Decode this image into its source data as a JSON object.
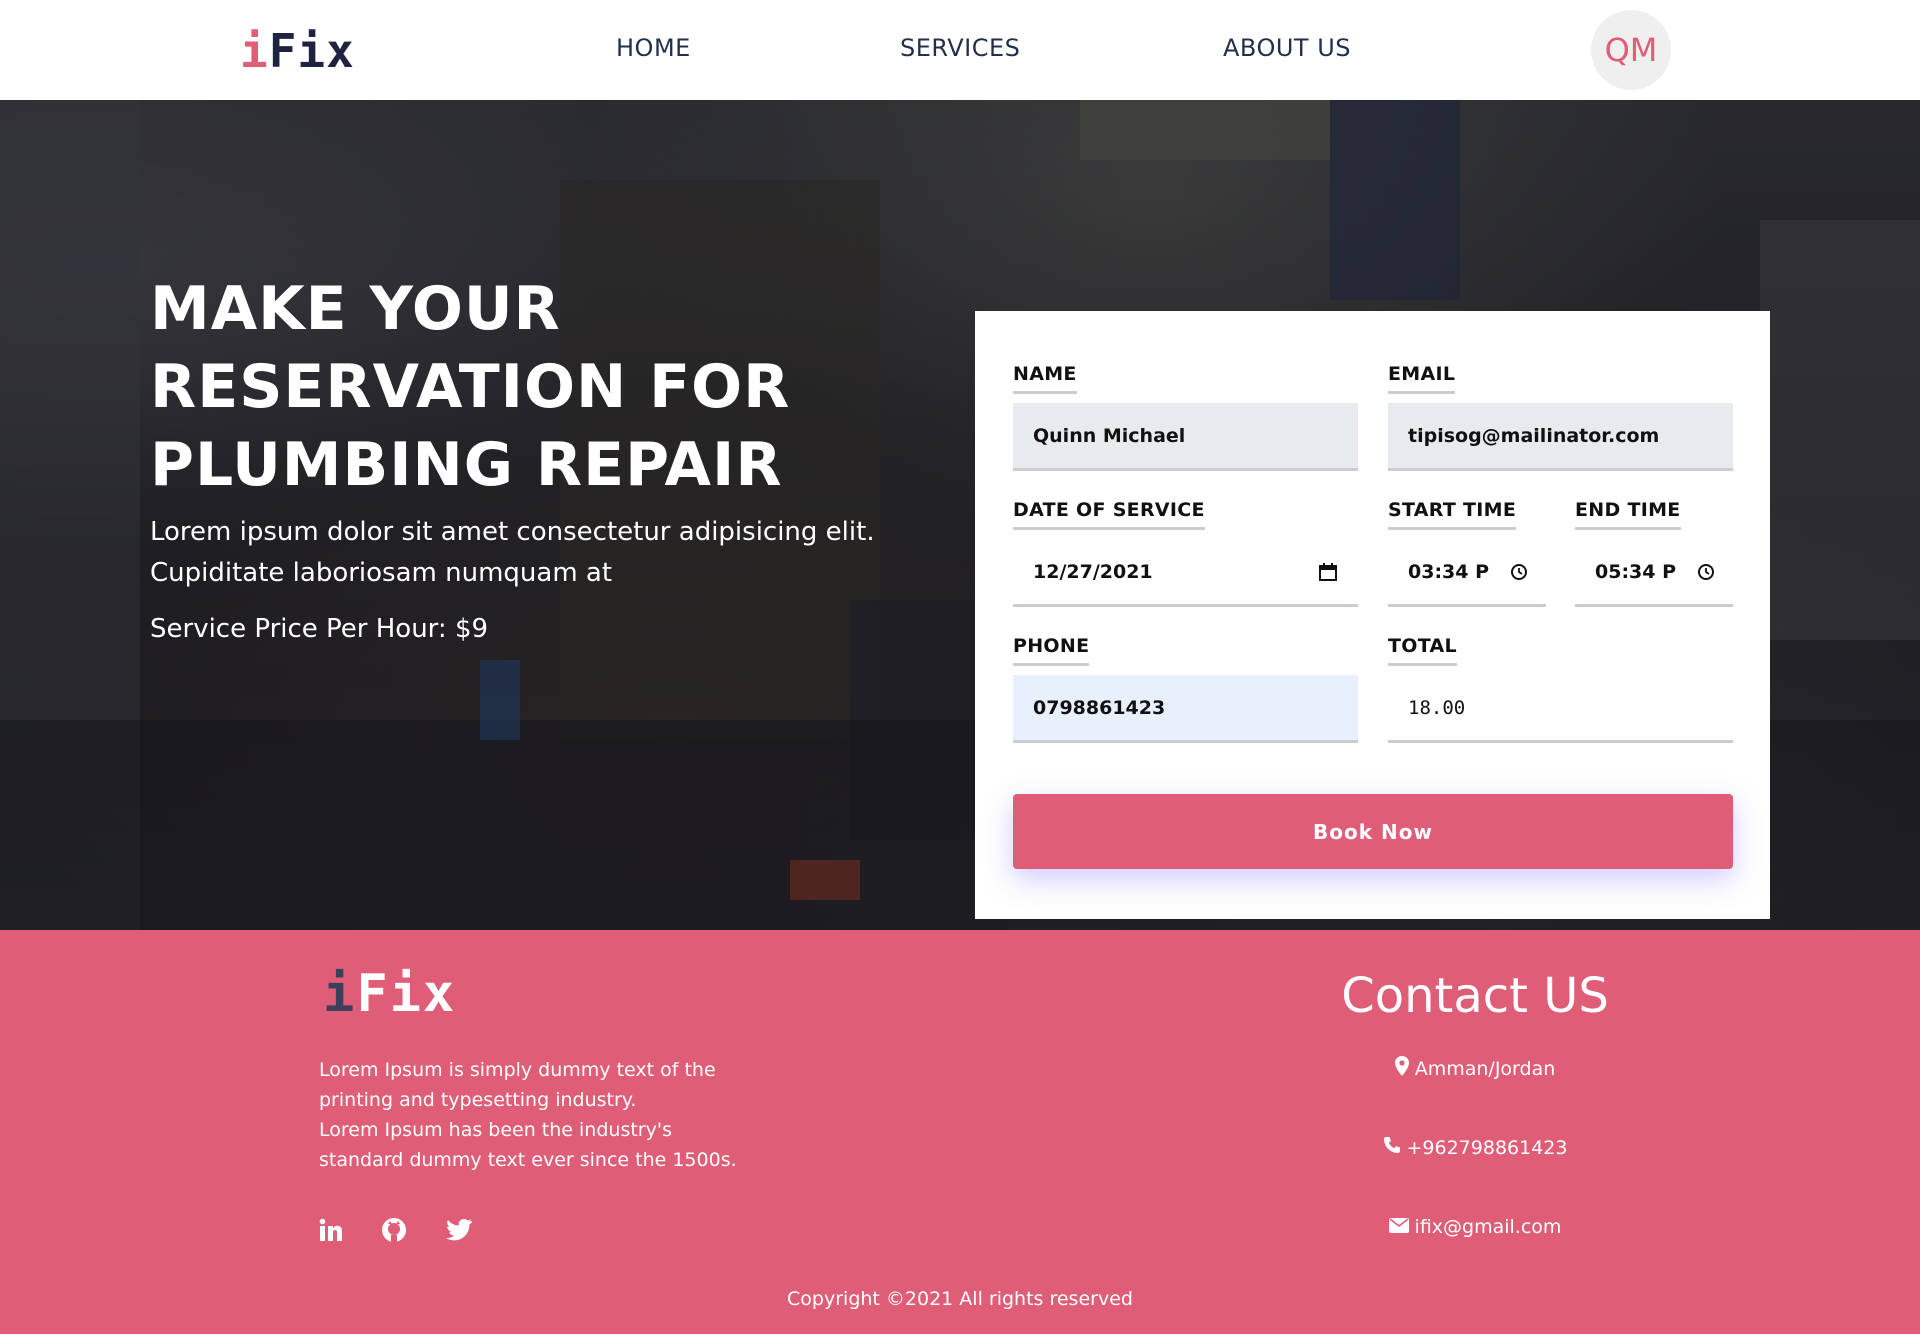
{
  "brand": {
    "logo_text_i": "i",
    "logo_text_rest": "Fix"
  },
  "nav": {
    "home": "HOME",
    "services": "SERVICES",
    "about": "ABOUT US",
    "avatar_initials": "QM"
  },
  "hero": {
    "title_lines": [
      "MAKE YOUR",
      "RESERVATION FOR",
      "PLUMBING REPAIR"
    ],
    "description_line1": "Lorem ipsum dolor sit amet consectetur adipisicing elit.",
    "description_line2": "Cupiditate laboriosam numquam at",
    "price": "Service Price Per Hour: $9"
  },
  "form": {
    "name_label": "NAME",
    "name_value": "Quinn Michael",
    "email_label": "EMAIL",
    "email_value": "tipisog@mailinator.com",
    "date_label": "DATE OF SERVICE",
    "date_value": "12/27/2021",
    "start_label": "START TIME",
    "start_value": "03:34 P",
    "end_label": "END TIME",
    "end_value": "05:34 P",
    "phone_label": "PHONE",
    "phone_value": "0798861423",
    "total_label": "TOTAL",
    "total_value": "18.00",
    "submit_label": "Book Now"
  },
  "footer": {
    "about_line1": "Lorem Ipsum is simply dummy text of the",
    "about_line2": "printing and typesetting industry.",
    "about_line3": "Lorem Ipsum has been the industry's",
    "about_line4": "standard dummy text ever since the 1500s.",
    "social": [
      "linkedin-icon",
      "github-icon",
      "twitter-icon"
    ],
    "contact_title": "Contact US",
    "location": "Amman/Jordan",
    "phone": "+962798861423",
    "email": "ifix@gmail.com",
    "copyright": "Copyright ©2021 All rights reserved"
  },
  "colors": {
    "accent": "#e05d78",
    "nav_text": "#23304a",
    "input_bg": "#e8ebee",
    "autofill_bg": "#e8f0fe"
  }
}
